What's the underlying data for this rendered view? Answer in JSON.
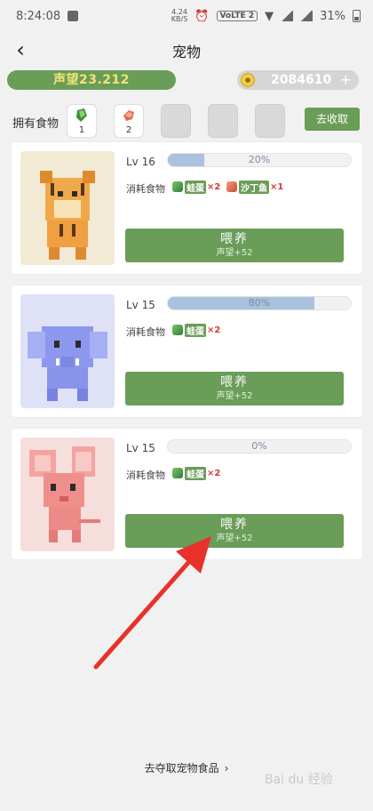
{
  "status": {
    "time": "8:24:08",
    "net_speed_top": "4.24",
    "net_speed_bottom": "KB/S",
    "lte": "VoLTE 2",
    "battery": "31%"
  },
  "header": {
    "title": "宠物"
  },
  "resources": {
    "reputation": "声望23.212",
    "coin_value": "2084610",
    "coin_plus": "+"
  },
  "foods": {
    "label": "拥有食物",
    "items": [
      {
        "count": "1",
        "color": "#3a8f3a"
      },
      {
        "count": "2",
        "color": "#e07050"
      }
    ],
    "collect_label": "去收取"
  },
  "pets": [
    {
      "level": "Lv 16",
      "progress_text": "20%",
      "progress": 0.2,
      "cost_label": "消耗食物",
      "costs": [
        {
          "name": "蛙蛋",
          "qty": "×2",
          "icon": "green-egg-icon"
        },
        {
          "name": "沙丁鱼",
          "qty": "×1",
          "icon": "meat-icon"
        }
      ],
      "feed_label": "喂养",
      "feed_sub": "声望+52",
      "bg": "#f3ead6",
      "animal": "tiger"
    },
    {
      "level": "Lv 15",
      "progress_text": "80%",
      "progress": 0.8,
      "cost_label": "消耗食物",
      "costs": [
        {
          "name": "蛙蛋",
          "qty": "×2",
          "icon": "green-egg-icon"
        }
      ],
      "feed_label": "喂养",
      "feed_sub": "声望+52",
      "bg": "#dfe2f7",
      "animal": "elephant"
    },
    {
      "level": "Lv 15",
      "progress_text": "0%",
      "progress": 0.0,
      "cost_label": "消耗食物",
      "costs": [
        {
          "name": "蛙蛋",
          "qty": "×2",
          "icon": "green-egg-icon"
        }
      ],
      "feed_label": "喂养",
      "feed_sub": "声望+52",
      "bg": "#f6dedd",
      "animal": "mouse"
    }
  ],
  "footer": {
    "link_text": "去夺取宠物食品",
    "chevron": "›"
  },
  "watermark": "Bai du 经验",
  "annotation_arrow_color": "#e8312a"
}
